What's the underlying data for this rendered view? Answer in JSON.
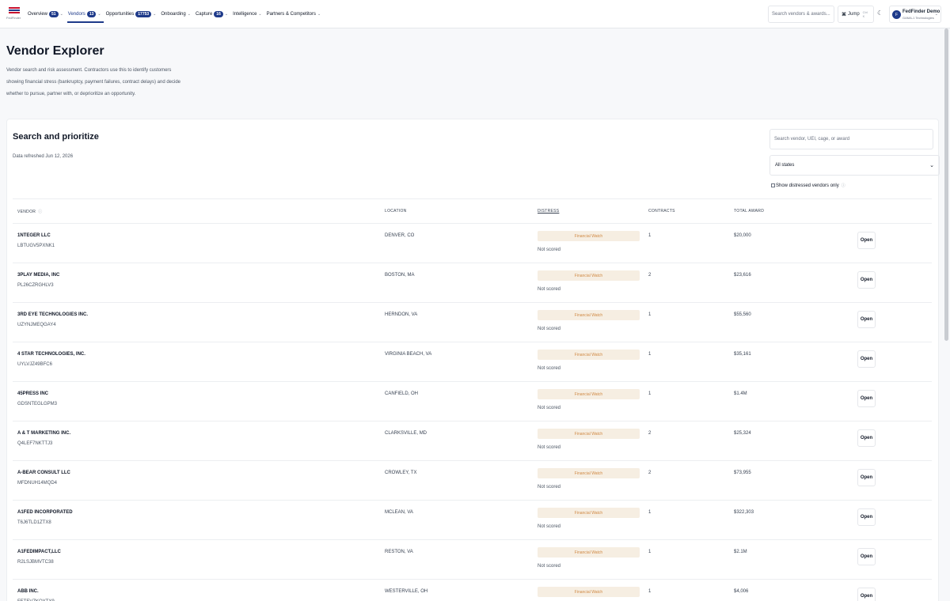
{
  "brand": {
    "logo_text": "FedFinder"
  },
  "nav": [
    {
      "label": "Overview",
      "badge": "51",
      "active": false
    },
    {
      "label": "Vendors",
      "badge": "13",
      "active": true
    },
    {
      "label": "Opportunities",
      "badge": "17753",
      "active": false
    },
    {
      "label": "Onboarding",
      "badge": "",
      "active": false
    },
    {
      "label": "Capture",
      "badge": "16",
      "active": false
    },
    {
      "label": "Intelligence",
      "badge": "",
      "active": false
    },
    {
      "label": "Partners & Competitors",
      "badge": "",
      "active": false
    }
  ],
  "header_tools": {
    "search_placeholder": "Search vendors & awards...",
    "jump_label": "Jump",
    "jump_shortcut": "Ctrl K",
    "user_name": "FedFinder Demo",
    "user_org": "GAMA-1 Technologies",
    "user_initial": "F"
  },
  "page": {
    "title": "Vendor Explorer",
    "description": "Vendor search and risk assessment. Contractors use this to identify customers showing financial stress (bankruptcy, payment failures, contract delays) and decide whether to pursue, partner with, or deprioritize an opportunity."
  },
  "card": {
    "title": "Search and prioritize",
    "refreshed": "Data refreshed Jun 12, 2026",
    "search_placeholder": "Search vendor, UEI, cage, or award",
    "state_selected": "All states",
    "distressed_toggle_label": "Show distressed vendors only"
  },
  "table": {
    "columns": [
      "VENDOR",
      "LOCATION",
      "DISTRESS",
      "CONTRACTS",
      "TOTAL AWARD"
    ],
    "open_label": "Open",
    "rows": [
      {
        "name": "1NTEGER LLC",
        "uei": "LBTUGV5PXNK1",
        "location": "DENVER, CO",
        "distress": "Financial Watch",
        "score": "Not scored",
        "contracts": "1",
        "award": "$20,000"
      },
      {
        "name": "3PLAY MEDIA, INC",
        "uei": "PL26CZRGHLV3",
        "location": "BOSTON, MA",
        "distress": "Financial Watch",
        "score": "Not scored",
        "contracts": "2",
        "award": "$23,616"
      },
      {
        "name": "3RD EYE TECHNOLOGIES INC.",
        "uei": "UZYNJMEQGAY4",
        "location": "HERNDON, VA",
        "distress": "Financial Watch",
        "score": "Not scored",
        "contracts": "1",
        "award": "$55,560"
      },
      {
        "name": "4 STAR TECHNOLOGIES, INC.",
        "uei": "UYLVJZ49BFC6",
        "location": "VIRGINIA BEACH, VA",
        "distress": "Financial Watch",
        "score": "Not scored",
        "contracts": "1",
        "award": "$35,161"
      },
      {
        "name": "45PRESS INC",
        "uei": "GDSNTEGLGPM3",
        "location": "CANFIELD, OH",
        "distress": "Financial Watch",
        "score": "Not scored",
        "contracts": "1",
        "award": "$1.4M"
      },
      {
        "name": "A & T MARKETING INC.",
        "uei": "Q4LEF7NKTTJ3",
        "location": "CLARKSVILLE, MD",
        "distress": "Financial Watch",
        "score": "Not scored",
        "contracts": "2",
        "award": "$25,324"
      },
      {
        "name": "A-BEAR CONSULT LLC",
        "uei": "MFDNUH14MQD4",
        "location": "CROWLEY, TX",
        "distress": "Financial Watch",
        "score": "Not scored",
        "contracts": "2",
        "award": "$73,955"
      },
      {
        "name": "A1FED INCORPORATED",
        "uei": "T6J6TLD1ZTX8",
        "location": "MCLEAN, VA",
        "distress": "Financial Watch",
        "score": "Not scored",
        "contracts": "1",
        "award": "$322,303"
      },
      {
        "name": "A1FEDIMPACT,LLC",
        "uei": "R2LSJBMVTC38",
        "location": "RESTON, VA",
        "distress": "Financial Watch",
        "score": "Not scored",
        "contracts": "1",
        "award": "$2.1M"
      },
      {
        "name": "ABB INC.",
        "uei": "FETEVZKQYTX9",
        "location": "WESTERVILLE, OH",
        "distress": "Financial Watch",
        "score": "Not scored",
        "contracts": "1",
        "award": "$4,006"
      }
    ]
  },
  "icons": {
    "sort_info": "info-icon",
    "theme": "moon-icon",
    "jump": "command-icon"
  },
  "colors": {
    "accent": "#1e3a8a",
    "distress_bg": "#f6eee2",
    "distress_text": "#d08a45"
  }
}
